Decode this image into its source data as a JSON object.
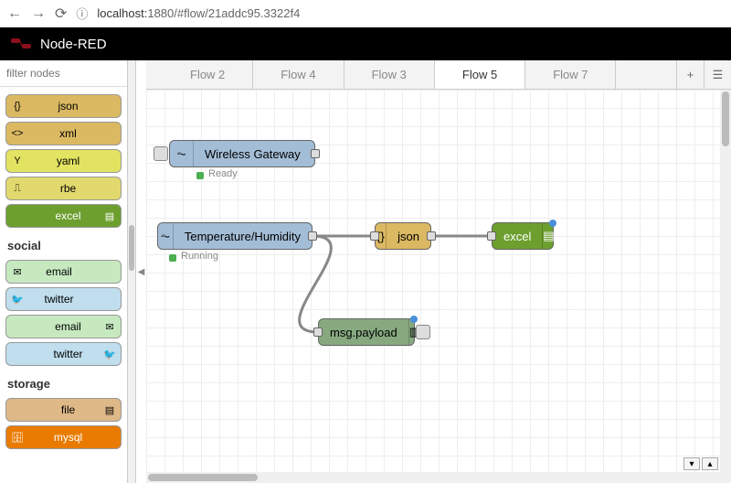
{
  "browser": {
    "url_prefix": "localhost:",
    "url_rest": "1880/#flow/21addc95.3322f4"
  },
  "header": {
    "title": "Node-RED"
  },
  "sidebar": {
    "search_placeholder": "filter nodes",
    "nodes_parser": [
      {
        "label": "json",
        "cls": "json-color"
      },
      {
        "label": "xml",
        "cls": "xml-color"
      },
      {
        "label": "yaml",
        "cls": "yaml-color"
      },
      {
        "label": "rbe",
        "cls": "rbe-color"
      },
      {
        "label": "excel",
        "cls": "excel-color"
      }
    ],
    "cat_social": "social",
    "social_nodes": [
      {
        "label": "email",
        "cls": "email-color",
        "side": "left"
      },
      {
        "label": "twitter",
        "cls": "twitter-color",
        "side": "left"
      },
      {
        "label": "email",
        "cls": "email-color",
        "side": "right"
      },
      {
        "label": "twitter",
        "cls": "twitter-color",
        "side": "right"
      }
    ],
    "cat_storage": "storage",
    "storage_nodes": [
      {
        "label": "file",
        "cls": "file-color"
      },
      {
        "label": "mysql",
        "cls": "mysql-color"
      }
    ]
  },
  "tabs": {
    "items": [
      "Flow 2",
      "Flow 4",
      "Flow 3",
      "Flow 5",
      "Flow 7"
    ],
    "active_index": 3
  },
  "canvas": {
    "wireless": {
      "label": "Wireless Gateway",
      "status": "Ready"
    },
    "temphum": {
      "label": "Temperature/Humidity",
      "status": "Running"
    },
    "json": {
      "label": "json"
    },
    "excel": {
      "label": "excel"
    },
    "debug": {
      "label": "msg.payload"
    }
  }
}
